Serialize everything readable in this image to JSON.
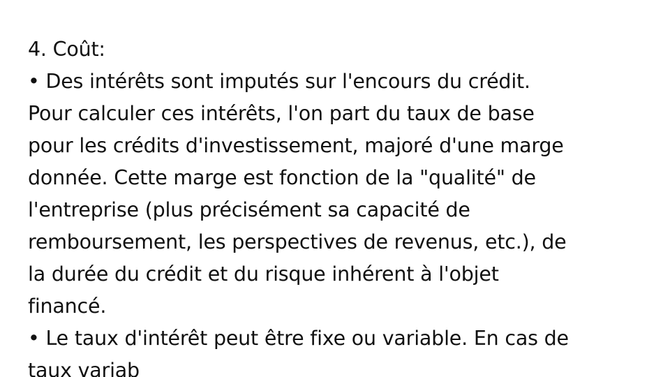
{
  "document": {
    "lines": [
      "4. Coût:",
      "• Des intérêts sont imputés sur l'encours du crédit.",
      "Pour calculer ces intérêts, l'on part du taux de base",
      "pour les crédits d'investissement, majoré d'une marge",
      "donnée. Cette marge est fonction de la \"qualité\" de",
      "l'entreprise (plus précisément sa capacité de",
      "remboursement, les perspectives de revenus, etc.), de",
      "la durée du crédit et du risque inhérent à l'objet",
      "financé.",
      "• Le taux d'intérêt peut être fixe ou variable. En cas de",
      "taux variab"
    ]
  }
}
